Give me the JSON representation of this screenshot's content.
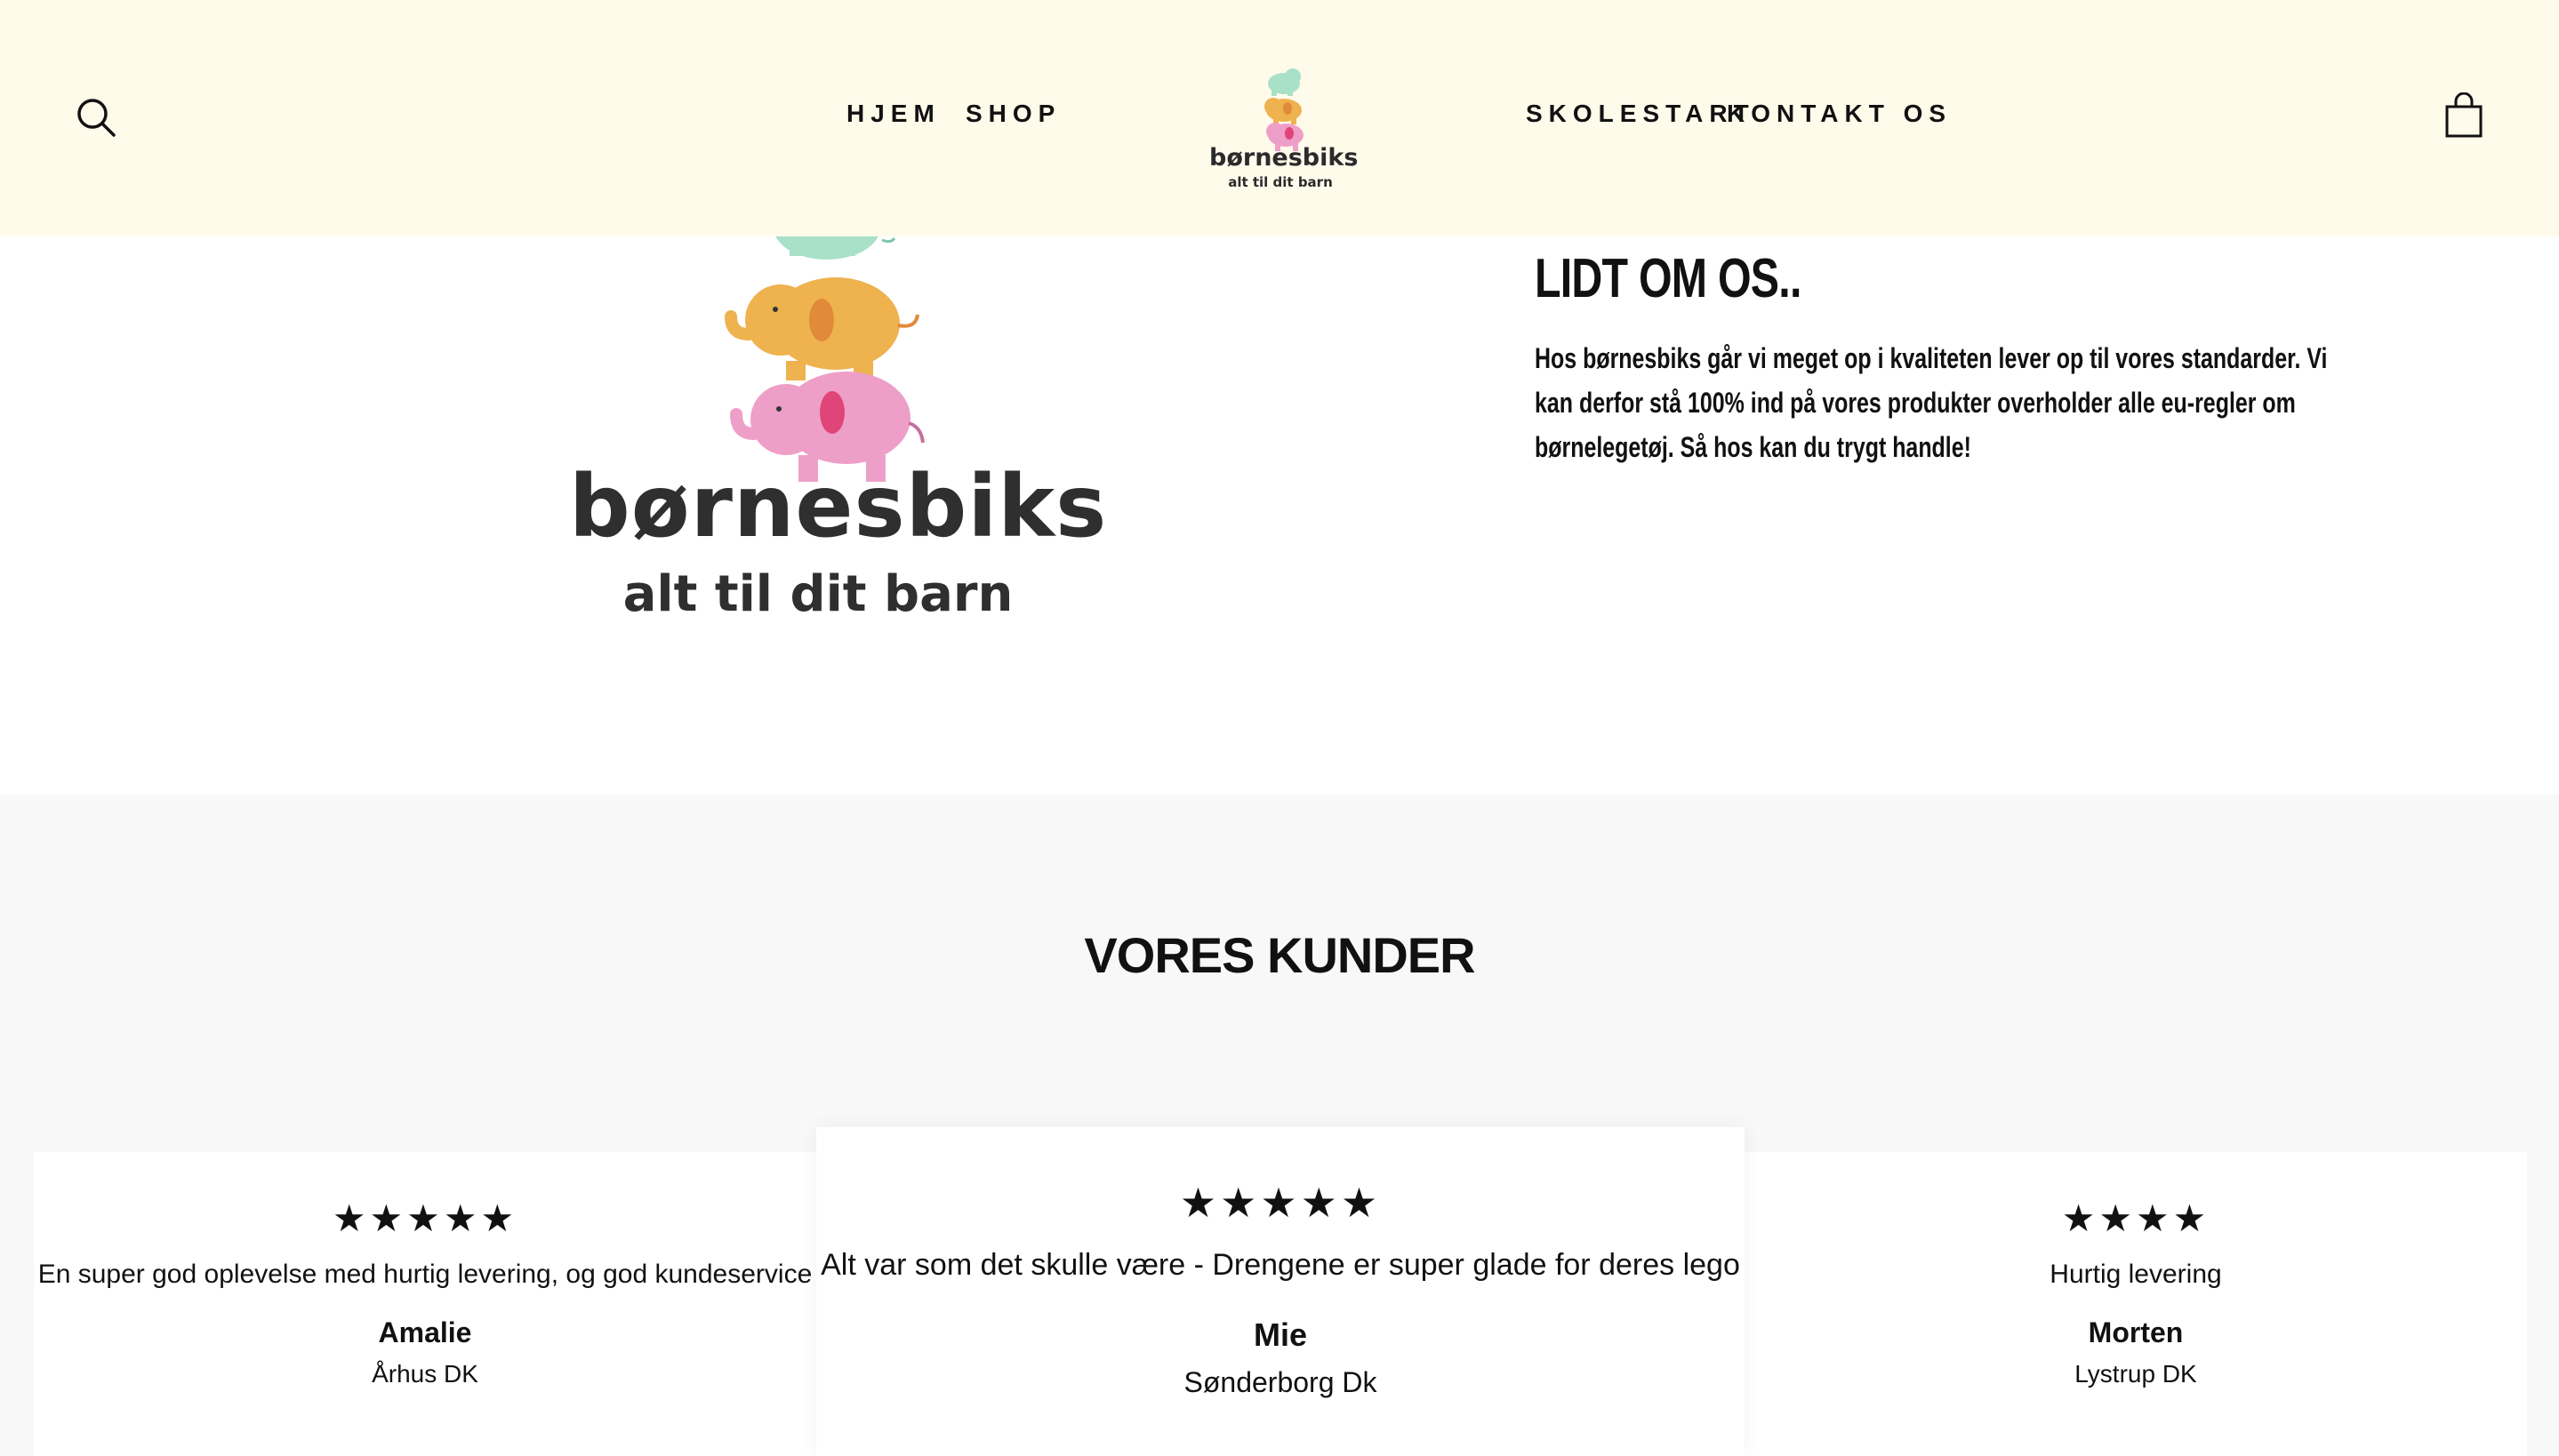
{
  "header": {
    "nav_left": [
      "HJEM",
      "SHOP"
    ],
    "nav_right": [
      "SKOLESTART",
      "KONTAKT OS"
    ],
    "logo": {
      "brand": "børnesbiks",
      "tagline": "alt til dit barn"
    },
    "icons": {
      "search": "search-icon",
      "cart": "shopping-bag-icon"
    }
  },
  "about": {
    "logo": {
      "brand": "børnesbiks",
      "tagline": "alt til dit barn"
    },
    "title": "LIDT OM OS..",
    "text": "Hos børnesbiks går vi meget op i kvaliteten lever op til vores standarder. Vi kan derfor stå 100% ind på vores produkter overholder alle eu-regler om børnelegetøj. Så hos kan du trygt handle!"
  },
  "customers": {
    "title": "VORES KUNDER",
    "reviews": [
      {
        "stars": "★★★★★",
        "text": "En super god oplevelse med hurtig levering, og god kundeservice",
        "name": "Amalie",
        "location": "Århus DK"
      },
      {
        "stars": "★★★★★",
        "text": "Alt var som det skulle være - Drengene er super glade for deres lego",
        "name": "Mie",
        "location": "Sønderborg Dk"
      },
      {
        "stars": "★★★★",
        "text": "Hurtig levering",
        "name": "Morten",
        "location": "Lystrup DK"
      }
    ]
  },
  "colors": {
    "header_bg": "#fffbeb",
    "section_bg": "#f8f8f8",
    "elephant_green": "#a8e0c8",
    "elephant_orange": "#eeb24f",
    "elephant_pink": "#ee9fc8"
  }
}
